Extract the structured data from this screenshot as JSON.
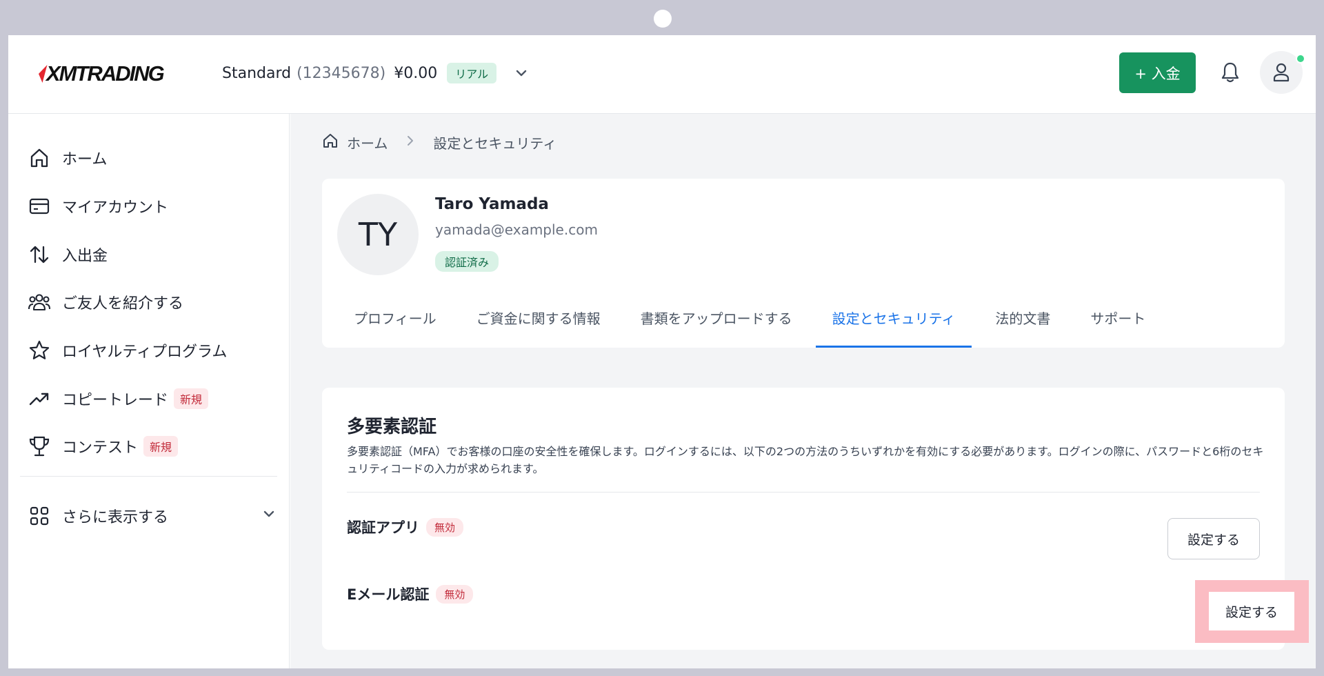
{
  "header": {
    "logo_text": "XMTRADING",
    "account_type": "Standard",
    "account_number": "(12345678)",
    "balance": "¥0.00",
    "account_mode": "リアル",
    "deposit_label": "+ 入金"
  },
  "sidebar": {
    "items": [
      {
        "label": "ホーム",
        "icon": "home-icon"
      },
      {
        "label": "マイアカウント",
        "icon": "card-icon"
      },
      {
        "label": "入出金",
        "icon": "transfer-arrows-icon"
      },
      {
        "label": "ご友人を紹介する",
        "icon": "people-icon"
      },
      {
        "label": "ロイヤルティプログラム",
        "icon": "star-icon"
      },
      {
        "label": "コピートレード",
        "icon": "trend-up-icon",
        "tag": "新規"
      },
      {
        "label": "コンテスト",
        "icon": "trophy-icon",
        "tag": "新規"
      }
    ],
    "more_label": "さらに表示する"
  },
  "breadcrumb": {
    "home": "ホーム",
    "current": "設定とセキュリティ"
  },
  "profile": {
    "initials": "TY",
    "name": "Taro Yamada",
    "email": "yamada@example.com",
    "status": "認証済み"
  },
  "tabs": [
    {
      "label": "プロフィール",
      "active": false
    },
    {
      "label": "ご資金に関する情報",
      "active": false
    },
    {
      "label": "書類をアップロードする",
      "active": false
    },
    {
      "label": "設定とセキュリティ",
      "active": true
    },
    {
      "label": "法的文書",
      "active": false
    },
    {
      "label": "サポート",
      "active": false
    }
  ],
  "mfa": {
    "title": "多要素認証",
    "description": "多要素認証（MFA）でお客様の口座の安全性を確保します。ログインするには、以下の2つの方法のうちいずれかを有効にする必要があります。ログインの際に、パスワードと6桁のセキュリティコードの入力が求められます。",
    "methods": [
      {
        "label": "認証アプリ",
        "status": "無効",
        "button": "設定する"
      },
      {
        "label": "Eメール認証",
        "status": "無効",
        "button": "設定する"
      }
    ]
  },
  "colors": {
    "accent_green": "#17935e",
    "active_tab_blue": "#1a73e8",
    "highlight_pink": "#fbbcc3"
  }
}
